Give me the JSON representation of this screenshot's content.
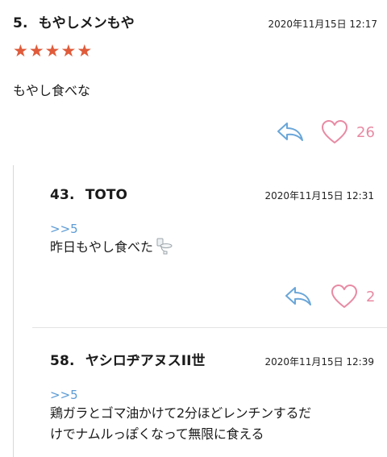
{
  "comments": [
    {
      "number": "5.",
      "author": "もやしメンもや",
      "date": "2020年11月15日 12:17",
      "rating_stars": 5,
      "body": "もやし食べな",
      "like_count": "26"
    },
    {
      "number": "43.",
      "author": "TOTO",
      "date": "2020年11月15日 12:31",
      "reply_to": ">>5",
      "body": "昨日もやし食べた",
      "body_icon": "toilet-icon",
      "like_count": "2"
    },
    {
      "number": "58.",
      "author": "ヤシロヂアヌスII世",
      "date": "2020年11月15日 12:39",
      "reply_to": ">>5",
      "body_line1": "鶏ガラとゴマ油かけて2分ほどレンチンするだ",
      "body_line2": "けでナムルっぽくなって無限に食える"
    }
  ],
  "colors": {
    "star": "#e05b3a",
    "reply_link": "#5b9bd5",
    "heart": "#e88aa3",
    "reply_icon": "#6aa6d8"
  }
}
